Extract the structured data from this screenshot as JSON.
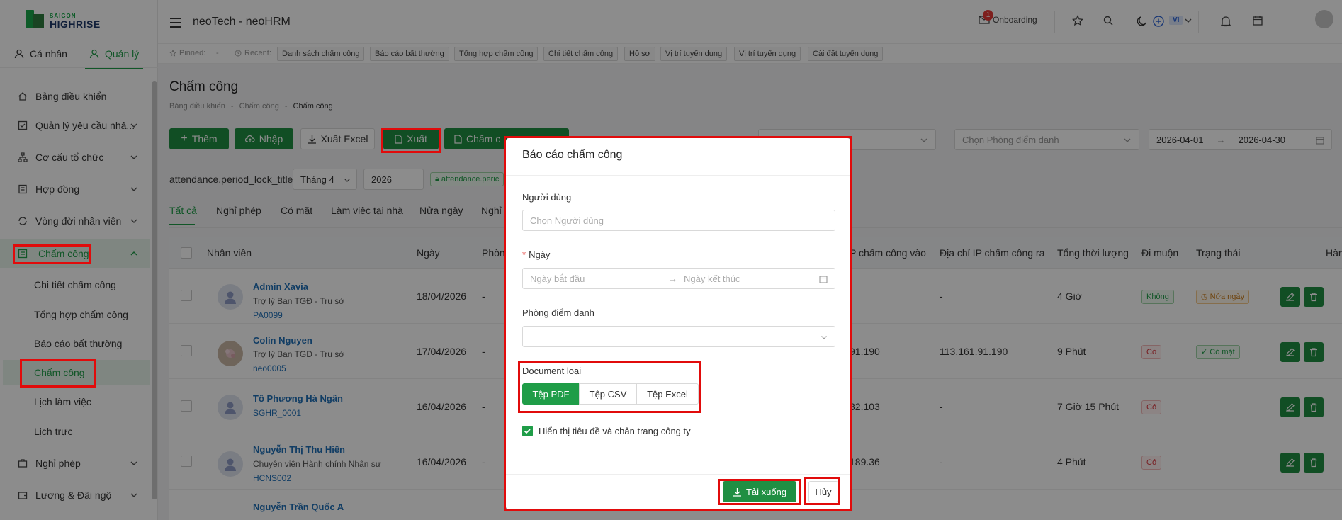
{
  "logo": {
    "line1": "SAIGON",
    "line2": "HIGHRISE"
  },
  "header": {
    "title": "neoTech - neoHRM",
    "onboarding_count": "1",
    "onboarding_label": "Onboarding",
    "lang": "VI"
  },
  "user_tabs": {
    "personal": "Cá nhân",
    "manage": "Quản lý"
  },
  "sidebar": {
    "items": [
      {
        "label": "Bảng điều khiển"
      },
      {
        "label": "Quản lý yêu cầu nhâ..."
      },
      {
        "label": "Cơ cấu tổ chức"
      },
      {
        "label": "Hợp đồng"
      },
      {
        "label": "Vòng đời nhân viên"
      },
      {
        "label": "Chấm công"
      },
      {
        "label": "Nghỉ phép"
      },
      {
        "label": "Lương & Đãi ngộ"
      }
    ],
    "sub_items": [
      {
        "label": "Chi tiết chấm công"
      },
      {
        "label": "Tổng hợp chấm công"
      },
      {
        "label": "Báo cáo bất thường"
      },
      {
        "label": "Chấm công"
      },
      {
        "label": "Lịch làm việc"
      },
      {
        "label": "Lịch trực"
      }
    ]
  },
  "pinbar": {
    "pinned_label": "Pinned:",
    "pinned_value": "-",
    "recent_label": "Recent:",
    "recent": [
      "Danh sách chấm công",
      "Báo cáo bất thường",
      "Tổng hợp chấm công",
      "Chi tiết chấm công",
      "Hồ sơ",
      "Vị trí tuyển dụng",
      "Vị trí tuyển dụng",
      "Cài đặt tuyển dụng"
    ]
  },
  "page": {
    "title": "Chấm công",
    "breadcrumb": [
      "Bảng điều khiển",
      "Chấm công",
      "Chấm công"
    ]
  },
  "toolbar": {
    "add": "Thêm",
    "import": "Nhập",
    "export_excel": "Xuất Excel",
    "export": "Xuất",
    "checkin_prefix": "Chấm c",
    "room_placeholder": "Chọn Phòng điểm danh",
    "date_from": "2026-04-01",
    "date_to": "2026-04-30"
  },
  "period": {
    "label": "attendance.period_lock_title",
    "month": "Tháng 4",
    "year": "2026",
    "lock_badge": "attendance.peric"
  },
  "tabs": [
    "Tất cả",
    "Nghỉ phép",
    "Có mặt",
    "Làm việc tại nhà",
    "Nửa ngày",
    "Nghỉ"
  ],
  "table": {
    "headers": {
      "employee": "Nhân viên",
      "date": "Ngày",
      "room": "Phòng",
      "ip_in": "P chấm công vào",
      "ip_out": "Địa chỉ IP chấm công ra",
      "total": "Tổng thời lượng",
      "late": "Đi muộn",
      "status": "Trạng thái",
      "action": "Hành động"
    },
    "rows": [
      {
        "name": "Admin Xavia",
        "position": "Trợ lý Ban TGĐ - Trụ sở",
        "code": "PA0099",
        "date": "18/04/2026",
        "room": "-",
        "ip_in": "",
        "ip_out": "-",
        "total": "4 Giờ",
        "late": "Không",
        "status": "Nửa ngày"
      },
      {
        "name": "Colin Nguyen",
        "position": "Trợ lý Ban TGĐ - Trụ sở",
        "code": "neo0005",
        "date": "17/04/2026",
        "room": "-",
        "ip_in": "91.190",
        "ip_out": "113.161.91.190",
        "total": "9 Phút",
        "late": "Có",
        "status": "Có mặt"
      },
      {
        "name": "Tô Phương Hà Ngân",
        "position": "",
        "code": "SGHR_0001",
        "date": "16/04/2026",
        "room": "-",
        "ip_in": "82.103",
        "ip_out": "-",
        "total": "7 Giờ 15 Phút",
        "late": "Có",
        "status": ""
      },
      {
        "name": "Nguyễn Thị Thu Hiền",
        "position": "Chuyên viên Hành chính Nhân sự",
        "code": "HCNS002",
        "date": "16/04/2026",
        "room": "-",
        "ip_in": "189.36",
        "ip_out": "-",
        "total": "4 Phút",
        "late": "Có",
        "status": ""
      },
      {
        "name": "Nguyễn Trần Quốc A",
        "position": "",
        "code": "",
        "date": "",
        "room": "",
        "ip_in": "",
        "ip_out": "",
        "total": "",
        "late": "",
        "status": ""
      }
    ]
  },
  "modal": {
    "title": "Báo cáo chấm công",
    "user_label": "Người dùng",
    "user_placeholder": "Chọn Người dùng",
    "date_label": "Ngày",
    "date_start_placeholder": "Ngày bắt đầu",
    "date_end_placeholder": "Ngày kết thúc",
    "room_label": "Phòng điểm danh",
    "doc_type_label": "Document loại",
    "doc_types": [
      "Tệp PDF",
      "Tệp CSV",
      "Tệp Excel"
    ],
    "selected_doc_type": "Tệp PDF",
    "show_header_footer": "Hiển thị tiêu đề và chân trang công ty",
    "show_header_footer_checked": true,
    "download": "Tải xuống",
    "cancel": "Hủy"
  }
}
